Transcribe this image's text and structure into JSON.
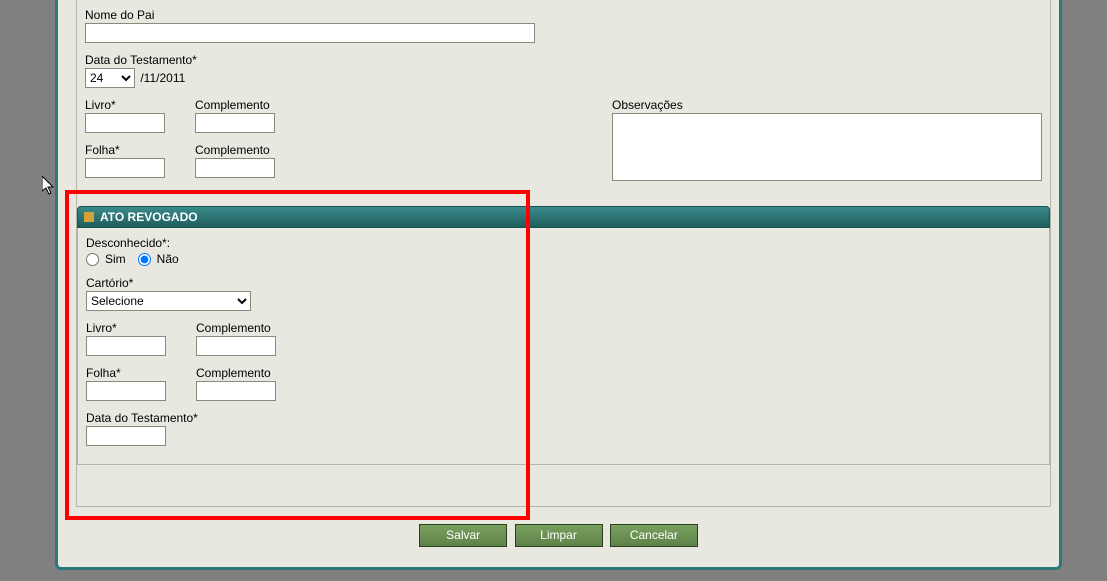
{
  "upper": {
    "nome_pai_label": "Nome do Pai",
    "data_testamento_label": "Data do Testamento*",
    "data_day": "24",
    "data_rest": "/11/2011",
    "livro_label": "Livro*",
    "complemento_label": "Complemento",
    "folha_label": "Folha*",
    "observacoes_label": "Observações"
  },
  "revogado": {
    "header": "ATO REVOGADO",
    "desconhecido_label": "Desconhecido*:",
    "sim": "Sim",
    "nao": "Não",
    "cartorio_label": "Cartório*",
    "cartorio_value": "Selecione",
    "livro_label": "Livro*",
    "complemento_label": "Complemento",
    "folha_label": "Folha*",
    "data_testamento_label": "Data do Testamento*"
  },
  "buttons": {
    "salvar": "Salvar",
    "limpar": "Limpar",
    "cancelar": "Cancelar"
  }
}
